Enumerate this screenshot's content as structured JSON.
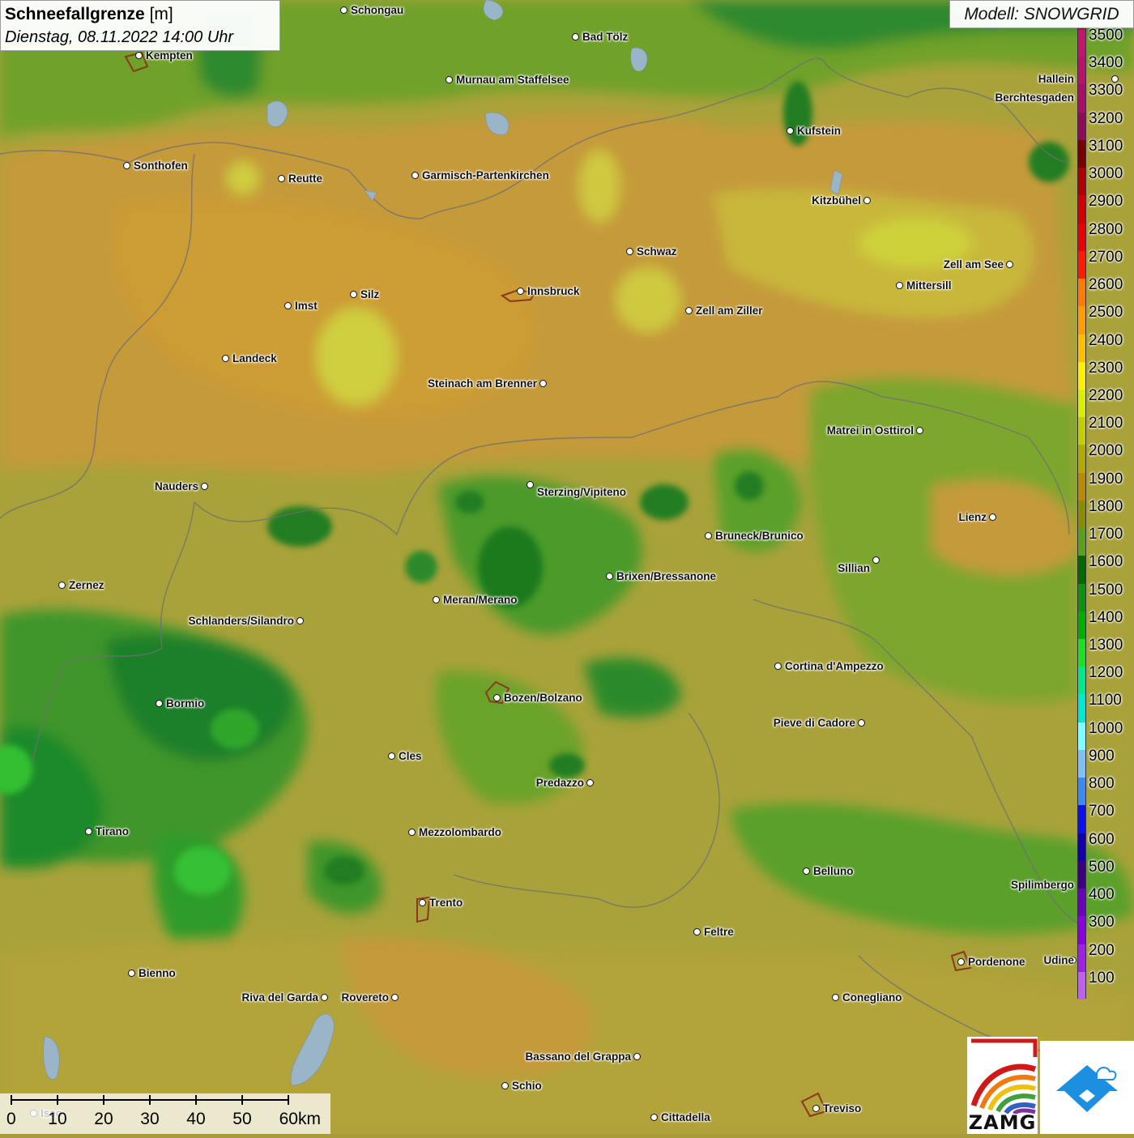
{
  "title": {
    "main": "Schneefallgrenze",
    "unit": "[m]",
    "datetime": "Dienstag, 08.11.2022 14:00 Uhr"
  },
  "model": "Modell: SNOWGRID",
  "legend": {
    "items": [
      {
        "label": "3500",
        "color": "#c4156e"
      },
      {
        "label": "3400",
        "color": "#b8126a"
      },
      {
        "label": "3300",
        "color": "#a80e66"
      },
      {
        "label": "3200",
        "color": "#900a5a"
      },
      {
        "label": "3100",
        "color": "#7a0000"
      },
      {
        "label": "3000",
        "color": "#b00000"
      },
      {
        "label": "2900",
        "color": "#d40000"
      },
      {
        "label": "2800",
        "color": "#ec0000"
      },
      {
        "label": "2700",
        "color": "#ff1a00"
      },
      {
        "label": "2600",
        "color": "#ff7a00"
      },
      {
        "label": "2500",
        "color": "#ff9d00"
      },
      {
        "label": "2400",
        "color": "#ffbf00"
      },
      {
        "label": "2300",
        "color": "#fff000"
      },
      {
        "label": "2200",
        "color": "#d8f000"
      },
      {
        "label": "2100",
        "color": "#c2d000"
      },
      {
        "label": "2000",
        "color": "#b2aa00"
      },
      {
        "label": "1900",
        "color": "#b88a00"
      },
      {
        "label": "1800",
        "color": "#8c8c00"
      },
      {
        "label": "1700",
        "color": "#5aa01e"
      },
      {
        "label": "1600",
        "color": "#006a00"
      },
      {
        "label": "1500",
        "color": "#109010"
      },
      {
        "label": "1400",
        "color": "#00b000"
      },
      {
        "label": "1300",
        "color": "#1ee01e"
      },
      {
        "label": "1200",
        "color": "#00e88a"
      },
      {
        "label": "1100",
        "color": "#00e8d0"
      },
      {
        "label": "1000",
        "color": "#80ffff"
      },
      {
        "label": "900",
        "color": "#80c0f0"
      },
      {
        "label": "800",
        "color": "#3a8cf0"
      },
      {
        "label": "700",
        "color": "#0a10f0"
      },
      {
        "label": "600",
        "color": "#1000b0"
      },
      {
        "label": "500",
        "color": "#3a0080"
      },
      {
        "label": "400",
        "color": "#6a00c0"
      },
      {
        "label": "300",
        "color": "#8a00e0"
      },
      {
        "label": "200",
        "color": "#a020e8"
      },
      {
        "label": "100",
        "color": "#c060f0"
      }
    ]
  },
  "cities": [
    {
      "name": "Schongau"
    },
    {
      "name": "Bad Tölz"
    },
    {
      "name": "Kempten"
    },
    {
      "name": "Murnau am Staffelsee"
    },
    {
      "name": "Hallein"
    },
    {
      "name": "Berchtesgaden"
    },
    {
      "name": "Kufstein"
    },
    {
      "name": "Sonthofen"
    },
    {
      "name": "Reutte"
    },
    {
      "name": "Garmisch-Partenkirchen"
    },
    {
      "name": "Kitzbühel"
    },
    {
      "name": "Schwaz"
    },
    {
      "name": "Zell am See"
    },
    {
      "name": "Mittersill"
    },
    {
      "name": "Innsbruck"
    },
    {
      "name": "Silz"
    },
    {
      "name": "Imst"
    },
    {
      "name": "Zell am Ziller"
    },
    {
      "name": "Landeck"
    },
    {
      "name": "Steinach am Brenner"
    },
    {
      "name": "Matrei in Osttirol"
    },
    {
      "name": "Nauders"
    },
    {
      "name": "Sterzing/Vipiteno"
    },
    {
      "name": "Lienz"
    },
    {
      "name": "Bruneck/Brunico"
    },
    {
      "name": "Sillian"
    },
    {
      "name": "Brixen/Bressanone"
    },
    {
      "name": "Zernez"
    },
    {
      "name": "Meran/Merano"
    },
    {
      "name": "Schlanders/Silandro"
    },
    {
      "name": "Cortina d'Ampezzo"
    },
    {
      "name": "Bozen/Bolzano"
    },
    {
      "name": "Bormio"
    },
    {
      "name": "Pieve di Cadore"
    },
    {
      "name": "Cles"
    },
    {
      "name": "Predazzo"
    },
    {
      "name": "Tirano"
    },
    {
      "name": "Mezzolombardo"
    },
    {
      "name": "Belluno"
    },
    {
      "name": "Spilimbergo"
    },
    {
      "name": "Trento"
    },
    {
      "name": "Feltre"
    },
    {
      "name": "Pordenone"
    },
    {
      "name": "Bienno"
    },
    {
      "name": "Riva del Garda"
    },
    {
      "name": "Rovereto"
    },
    {
      "name": "Conegliano"
    },
    {
      "name": "Bassano del Grappa"
    },
    {
      "name": "Schio"
    },
    {
      "name": "Treviso"
    },
    {
      "name": "Cittadella"
    },
    {
      "name": "Udine"
    },
    {
      "name": "Iseo"
    }
  ],
  "scale": {
    "labels": [
      "0",
      "10",
      "20",
      "30",
      "40",
      "50",
      "60km"
    ]
  },
  "logo": {
    "text": "ZAMG"
  }
}
